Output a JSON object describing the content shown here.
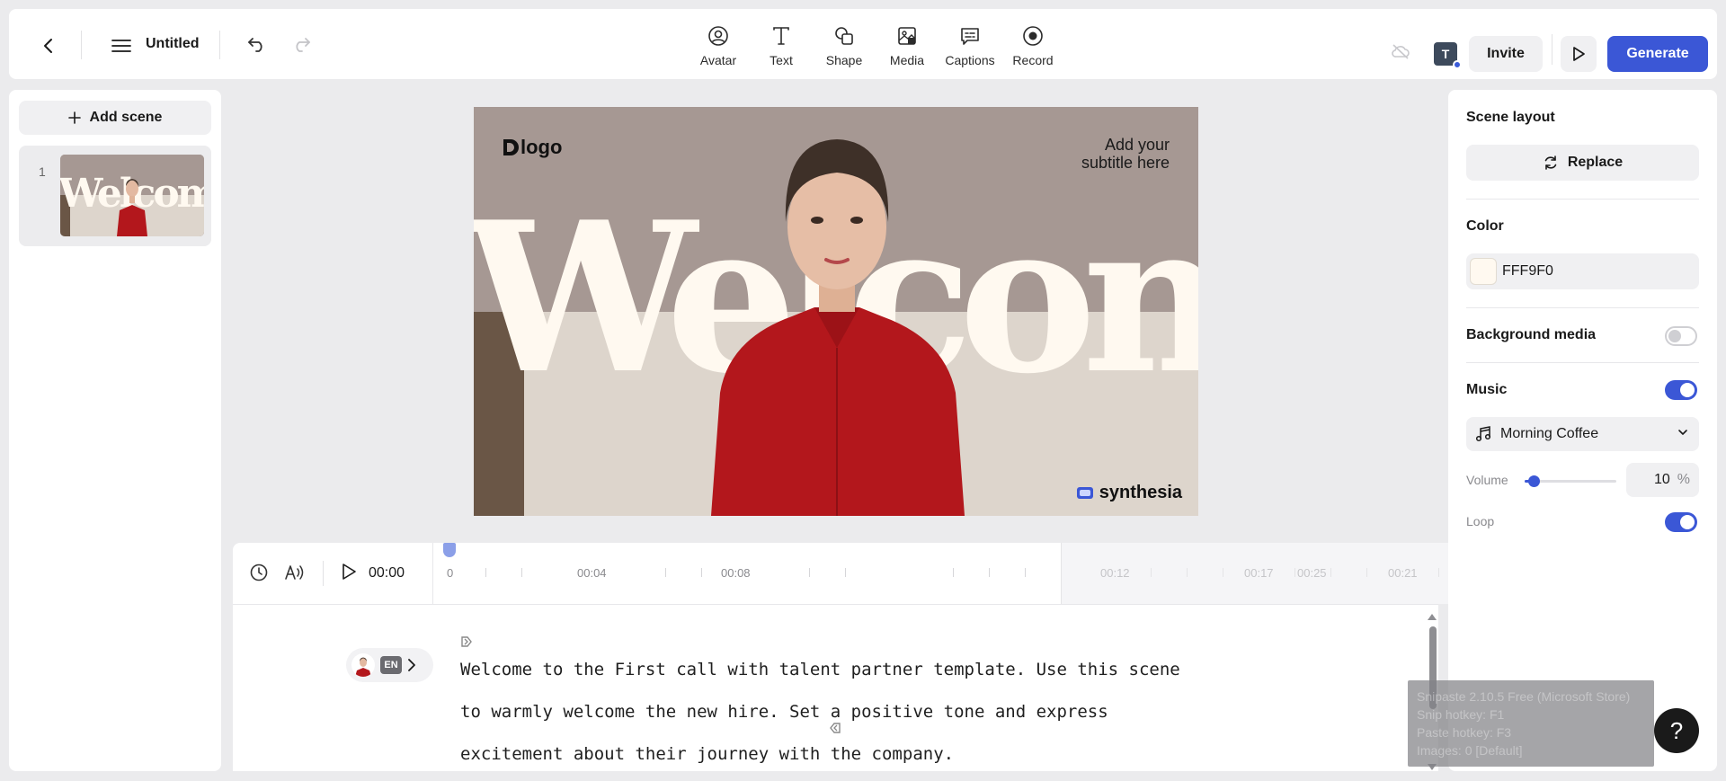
{
  "header": {
    "title": "Untitled",
    "tools": [
      {
        "label": "Avatar",
        "icon": "avatar-icon"
      },
      {
        "label": "Text",
        "icon": "text-icon"
      },
      {
        "label": "Shape",
        "icon": "shape-icon"
      },
      {
        "label": "Media",
        "icon": "media-icon"
      },
      {
        "label": "Captions",
        "icon": "captions-icon"
      },
      {
        "label": "Record",
        "icon": "record-icon"
      }
    ],
    "user_initial": "T",
    "invite_label": "Invite",
    "generate_label": "Generate",
    "accent_color": "#3b57d6"
  },
  "scenes": {
    "add_label": "Add scene",
    "items": [
      {
        "number": "1"
      }
    ]
  },
  "canvas": {
    "logo_text": "logo",
    "subtitle_line1": "Add your",
    "subtitle_line2": "subtitle here",
    "headline": "Welcome",
    "brand": "synthesia",
    "background_color": "#a69893",
    "headline_color": "#fff9f0"
  },
  "timeline": {
    "current_time": "00:00",
    "ticks": [
      "0",
      "00:04",
      "00:08",
      "00:12",
      "00:17",
      "00:21",
      "00:25"
    ]
  },
  "script": {
    "language": "EN",
    "text": "Welcome to the First call with talent partner template. Use this scene to warmly welcome the new hire. Set a positive tone and express excitement about their journey with the company."
  },
  "properties": {
    "scene_layout_label": "Scene layout",
    "replace_label": "Replace",
    "color_label": "Color",
    "color_value": "FFF9F0",
    "background_media_label": "Background media",
    "background_media_on": false,
    "music_label": "Music",
    "music_on": true,
    "music_track": "Morning Coffee",
    "volume_label": "Volume",
    "volume_value": "10",
    "volume_unit": "%",
    "volume_fraction": 0.1,
    "loop_label": "Loop",
    "loop_on": true
  },
  "overlay": {
    "line1": "Snipaste 2.10.5 Free (Microsoft Store)",
    "line2": "Snip hotkey: F1",
    "line3": "Paste hotkey: F3",
    "line4": "Images: 0 [Default]",
    "help": "?"
  }
}
